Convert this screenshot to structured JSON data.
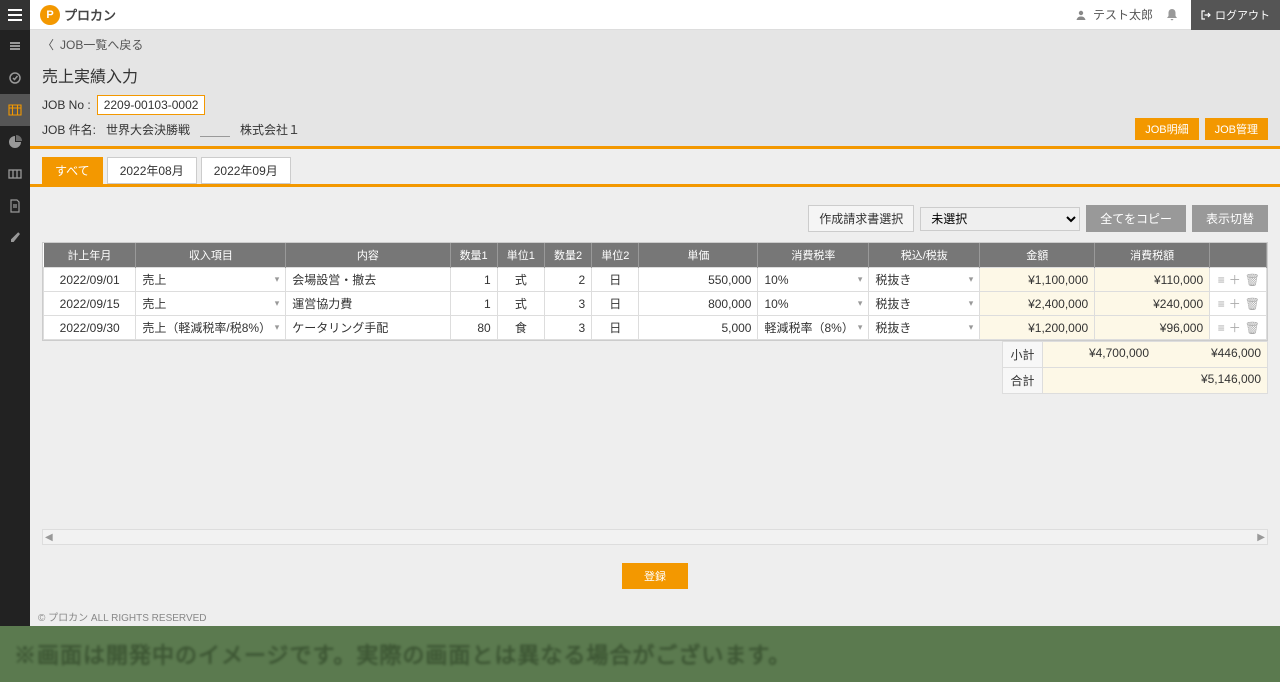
{
  "header": {
    "logo_text": "プロカン",
    "user_name": "テスト太郎",
    "logout_label": "ログアウト"
  },
  "crumb": {
    "back_label": "JOB一覧へ戻る"
  },
  "page": {
    "title": "売上実績入力",
    "jobno_label": "JOB No :",
    "jobno_value": "2209-00103-0002",
    "jobname_label": "JOB 件名:",
    "jobname_value": "世界大会決勝戦",
    "company": "株式会社１",
    "btn_job_detail": "JOB明細",
    "btn_job_manage": "JOB管理"
  },
  "tabs": [
    {
      "label": "すべて",
      "active": true
    },
    {
      "label": "2022年08月",
      "active": false
    },
    {
      "label": "2022年09月",
      "active": false
    }
  ],
  "toolbar": {
    "invoice_select_label": "作成請求書選択",
    "invoice_selected": "未選択",
    "copy_all": "全てをコピー",
    "toggle_view": "表示切替"
  },
  "columns": [
    "計上年月",
    "収入項目",
    "内容",
    "数量1",
    "単位1",
    "数量2",
    "単位2",
    "単価",
    "消費税率",
    "税込/税抜",
    "金額",
    "消費税額",
    ""
  ],
  "rows": [
    {
      "date": "2022/09/01",
      "item": "売上",
      "desc": "会場設営・撤去",
      "q1": "1",
      "u1": "式",
      "q2": "2",
      "u2": "日",
      "unit_price": "550,000",
      "tax_rate": "10%",
      "tax_type": "税抜き",
      "amount": "¥1,100,000",
      "tax_amount": "¥110,000"
    },
    {
      "date": "2022/09/15",
      "item": "売上",
      "desc": "運営協力費",
      "q1": "1",
      "u1": "式",
      "q2": "3",
      "u2": "日",
      "unit_price": "800,000",
      "tax_rate": "10%",
      "tax_type": "税抜き",
      "amount": "¥2,400,000",
      "tax_amount": "¥240,000"
    },
    {
      "date": "2022/09/30",
      "item": "売上（軽減税率/税8%）",
      "desc": "ケータリング手配",
      "q1": "80",
      "u1": "食",
      "q2": "3",
      "u2": "日",
      "unit_price": "5,000",
      "tax_rate": "軽減税率（8%）",
      "tax_type": "税抜き",
      "amount": "¥1,200,000",
      "tax_amount": "¥96,000"
    }
  ],
  "totals": {
    "subtotal_label": "小計",
    "subtotal_amount": "¥4,700,000",
    "subtotal_tax": "¥446,000",
    "total_label": "合計",
    "total_value": "¥5,146,000"
  },
  "register_label": "登録",
  "copyright": "© プロカン ALL RIGHTS RESERVED",
  "banner": "※画面は開発中のイメージです。実際の画面とは異なる場合がございます。"
}
